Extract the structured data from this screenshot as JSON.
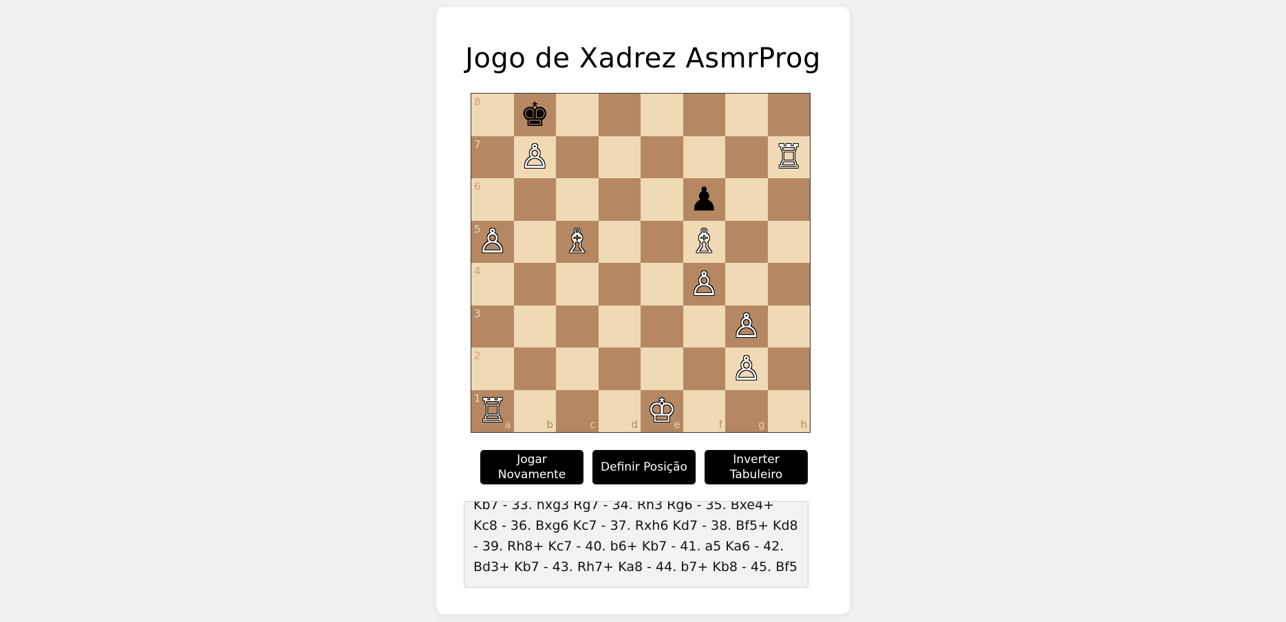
{
  "title": "Jogo de Xadrez AsmrProg",
  "board": {
    "light_color": "#f0d9b5",
    "dark_color": "#b58863",
    "ranks": [
      "8",
      "7",
      "6",
      "5",
      "4",
      "3",
      "2",
      "1"
    ],
    "files": [
      "a",
      "b",
      "c",
      "d",
      "e",
      "f",
      "g",
      "h"
    ],
    "pieces": [
      {
        "square": "b8",
        "color": "black",
        "type": "king",
        "glyph": "♚"
      },
      {
        "square": "b7",
        "color": "white",
        "type": "pawn",
        "glyph": "♙"
      },
      {
        "square": "h7",
        "color": "white",
        "type": "rook",
        "glyph": "♖"
      },
      {
        "square": "f6",
        "color": "black",
        "type": "pawn",
        "glyph": "♟"
      },
      {
        "square": "a5",
        "color": "white",
        "type": "pawn",
        "glyph": "♙"
      },
      {
        "square": "c5",
        "color": "white",
        "type": "bishop",
        "glyph": "♗"
      },
      {
        "square": "f5",
        "color": "white",
        "type": "bishop",
        "glyph": "♗"
      },
      {
        "square": "f4",
        "color": "white",
        "type": "pawn",
        "glyph": "♙"
      },
      {
        "square": "g3",
        "color": "white",
        "type": "pawn",
        "glyph": "♙"
      },
      {
        "square": "g2",
        "color": "white",
        "type": "pawn",
        "glyph": "♙"
      },
      {
        "square": "a1",
        "color": "white",
        "type": "rook",
        "glyph": "♖"
      },
      {
        "square": "e1",
        "color": "white",
        "type": "king",
        "glyph": "♔"
      }
    ]
  },
  "buttons": {
    "play_again": "Jogar Novamente",
    "set_position": "Definir Posição",
    "flip_board": "Inverter Tabuleiro"
  },
  "move_history": "Kb7 - 33. hxg3 Rg7 - 34. Rh3 Rg6 - 35. Bxe4+ Kc8 - 36. Bxg6 Kc7 - 37. Rxh6 Kd7 - 38. Bf5+ Kd8 - 39. Rh8+ Kc7 - 40. b6+ Kb7 - 41. a5 Ka6 - 42. Bd3+ Kb7 - 43. Rh7+ Ka8 - 44. b7+ Kb8 - 45. Bf5"
}
